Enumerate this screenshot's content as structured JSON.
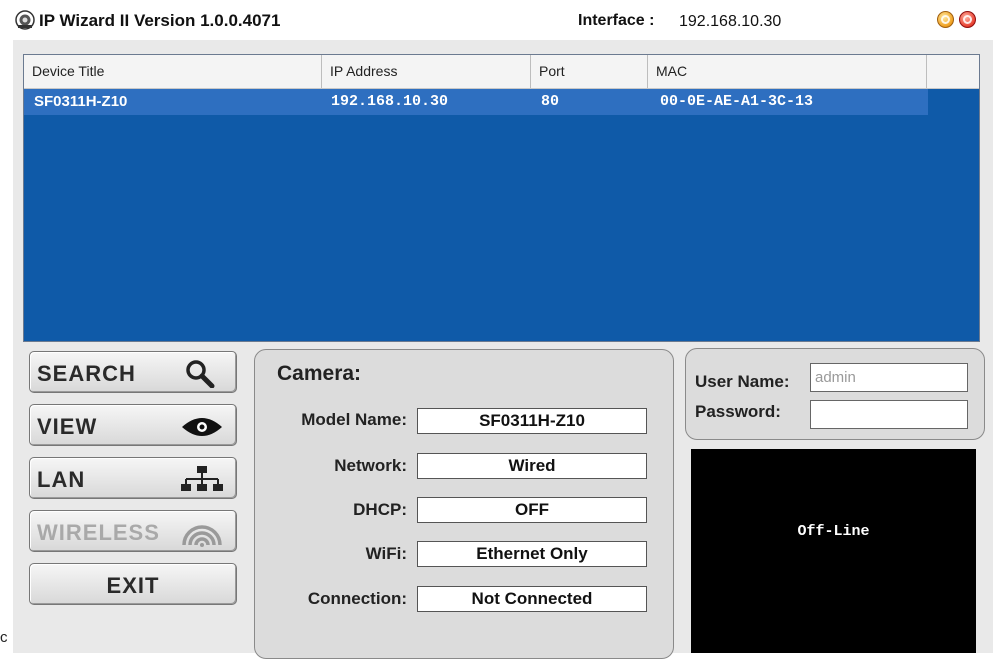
{
  "window": {
    "title": "IP Wizard II  Version 1.0.0.4071",
    "interface_label": "Interface :",
    "interface_value": "192.168.10.30",
    "buttons": {
      "minimize_icon": "orange-circle",
      "close_icon": "red-circle"
    }
  },
  "device_list": {
    "columns": [
      "Device Title",
      "IP Address",
      "Port",
      "MAC"
    ],
    "rows": [
      {
        "title": "SF0311H-Z10",
        "ip": "192.168.10.30",
        "port": "80",
        "mac": "00-0E-AE-A1-3C-13"
      }
    ],
    "colors": {
      "background": "#0f5aa8",
      "selected_row": "#2e6fc0"
    }
  },
  "actions": {
    "search": "SEARCH",
    "view": "VIEW",
    "lan": "LAN",
    "wireless": "WIRELESS",
    "exit": "EXIT"
  },
  "camera": {
    "heading": "Camera:",
    "model_name_label": "Model Name:",
    "model_name": "SF0311H-Z10",
    "network_label": "Network:",
    "network": "Wired",
    "dhcp_label": "DHCP:",
    "dhcp": "OFF",
    "wifi_label": "WiFi:",
    "wifi": "Ethernet Only",
    "connection_label": "Connection:",
    "connection": "Not Connected"
  },
  "login": {
    "username_label": "User Name:",
    "username_value": "admin",
    "password_label": "Password:",
    "password_value": ""
  },
  "video": {
    "status": "Off-Line"
  },
  "stray_text": "c"
}
